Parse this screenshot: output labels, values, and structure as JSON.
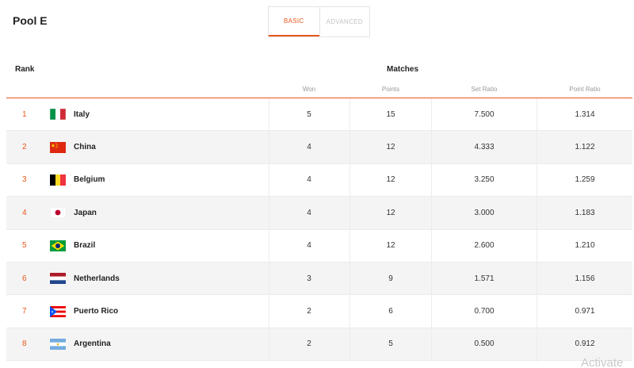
{
  "header": {
    "title": "Pool E",
    "tabs": [
      {
        "label": "BASIC",
        "active": true
      },
      {
        "label": "ADVANCED",
        "active": false
      }
    ]
  },
  "table": {
    "rank_label": "Rank",
    "group_label": "Matches",
    "columns": [
      "Won",
      "Points",
      "Set Ratio",
      "Point Ratio"
    ],
    "rows": [
      {
        "rank": "1",
        "team": "Italy",
        "flag_icon": "italy-flag-icon",
        "won": "5",
        "points": "15",
        "set_ratio": "7.500",
        "point_ratio": "1.314"
      },
      {
        "rank": "2",
        "team": "China",
        "flag_icon": "china-flag-icon",
        "won": "4",
        "points": "12",
        "set_ratio": "4.333",
        "point_ratio": "1.122"
      },
      {
        "rank": "3",
        "team": "Belgium",
        "flag_icon": "belgium-flag-icon",
        "won": "4",
        "points": "12",
        "set_ratio": "3.250",
        "point_ratio": "1.259"
      },
      {
        "rank": "4",
        "team": "Japan",
        "flag_icon": "japan-flag-icon",
        "won": "4",
        "points": "12",
        "set_ratio": "3.000",
        "point_ratio": "1.183"
      },
      {
        "rank": "5",
        "team": "Brazil",
        "flag_icon": "brazil-flag-icon",
        "won": "4",
        "points": "12",
        "set_ratio": "2.600",
        "point_ratio": "1.210"
      },
      {
        "rank": "6",
        "team": "Netherlands",
        "flag_icon": "netherlands-flag-icon",
        "won": "3",
        "points": "9",
        "set_ratio": "1.571",
        "point_ratio": "1.156"
      },
      {
        "rank": "7",
        "team": "Puerto Rico",
        "flag_icon": "puerto-rico-flag-icon",
        "won": "2",
        "points": "6",
        "set_ratio": "0.700",
        "point_ratio": "0.971"
      },
      {
        "rank": "8",
        "team": "Argentina",
        "flag_icon": "argentina-flag-icon",
        "won": "2",
        "points": "5",
        "set_ratio": "0.500",
        "point_ratio": "0.912"
      }
    ]
  },
  "colors": {
    "accent": "#e8571b",
    "row_alt": "#f4f4f4"
  },
  "watermark": "Activate"
}
